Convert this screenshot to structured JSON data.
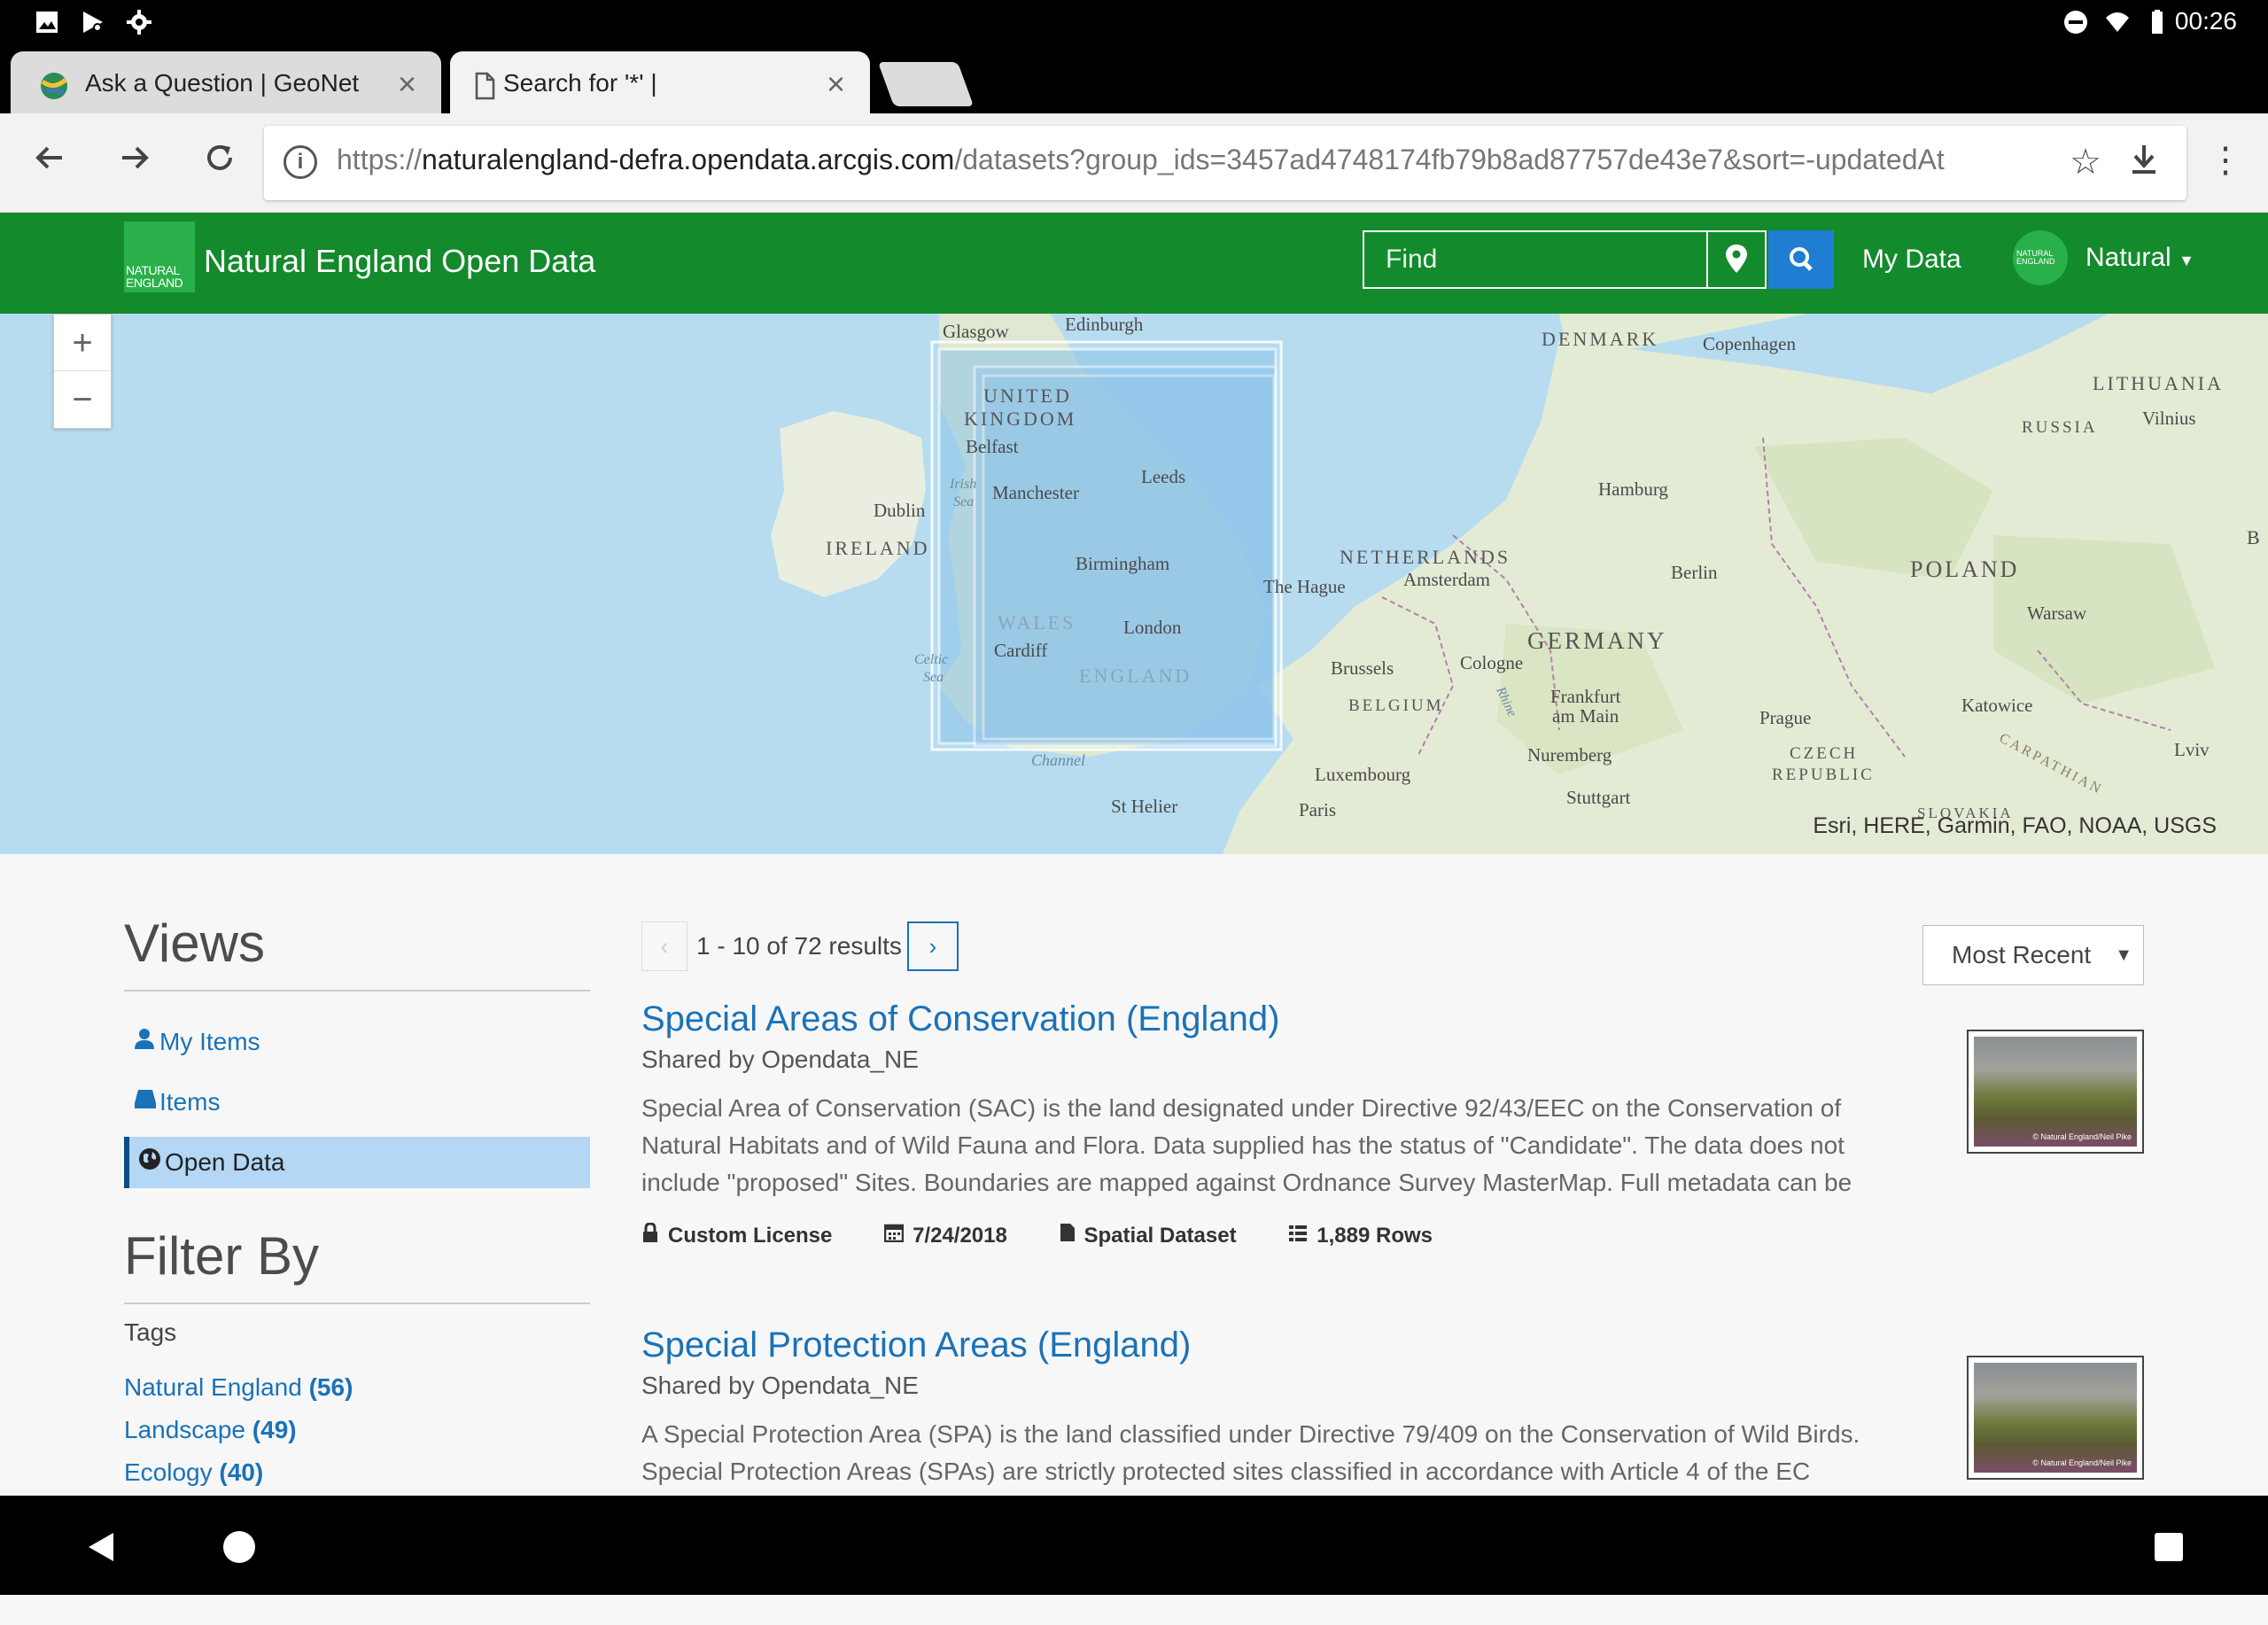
{
  "status_bar": {
    "time": "00:26",
    "left_icons": [
      "image-icon",
      "play-store-icon",
      "settings-gear-icon"
    ],
    "right_icons": [
      "do-not-disturb-icon",
      "wifi-icon",
      "battery-icon"
    ]
  },
  "browser": {
    "tabs": [
      {
        "title": "Ask a Question | GeoNet",
        "favicon": "globe-favicon",
        "active": false
      },
      {
        "title": "Search for '*' |",
        "favicon": "page-icon",
        "active": true
      }
    ],
    "url_host": "naturalengland-defra.opendata.arcgis.com",
    "url_scheme": "https://",
    "url_path": "/datasets?group_ids=3457ad4748174fb79b8ad87757de43e7&sort=-updatedAt"
  },
  "header": {
    "logo_text": "NATURAL ENGLAND",
    "title": "Natural England Open Data",
    "find_placeholder": "Find",
    "my_data": "My Data",
    "avatar_text": "NATURAL ENGLAND",
    "user": "Natural",
    "accent": "#138a2c",
    "search_button_color": "#1f7ed1"
  },
  "map": {
    "zoom_in": "+",
    "zoom_out": "−",
    "attribution": "Esri, HERE, Garmin, FAO, NOAA, USGS",
    "labels": {
      "glasgow": "Glasgow",
      "edinburgh": "Edinburgh",
      "united": "UNITED",
      "kingdom": "KINGDOM",
      "belfast": "Belfast",
      "irish_sea": "Irish",
      "irish_sea2": "Sea",
      "dublin": "Dublin",
      "ireland": "IRELAND",
      "manchester": "Manchester",
      "leeds": "Leeds",
      "birmingham": "Birmingham",
      "wales": "WALES",
      "cardiff": "Cardiff",
      "london": "London",
      "england": "ENGLAND",
      "celtic": "Celtic",
      "celtic2": "Sea",
      "channel": "Channel",
      "st_helier": "St Helier",
      "denmark": "DENMARK",
      "copenhagen": "Copenhagen",
      "lithuania": "LITHUANIA",
      "vilnius": "Vilnius",
      "russia": "RUSSIA",
      "hamburg": "Hamburg",
      "netherlands": "NETHERLANDS",
      "amsterdam": "Amsterdam",
      "the_hague": "The Hague",
      "berlin": "Berlin",
      "poland": "POLAND",
      "warsaw": "Warsaw",
      "germany": "GERMANY",
      "brussels": "Brussels",
      "cologne": "Cologne",
      "belgium": "BELGIUM",
      "frankfurt": "Frankfurt",
      "am_main": "am Main",
      "prague": "Prague",
      "katowice": "Katowice",
      "lviv": "Lviv",
      "luxembourg": "Luxembourg",
      "nuremberg": "Nuremberg",
      "czech": "CZECH",
      "republic": "REPUBLIC",
      "paris": "Paris",
      "stuttgart": "Stuttgart",
      "slovakia": "SLOVAKIA",
      "carpathian": "CARPATHIAN",
      "rhine": "Rhine",
      "b": "B"
    }
  },
  "sidebar": {
    "views_title": "Views",
    "items": [
      {
        "label": "My Items",
        "icon": "user-icon",
        "active": false
      },
      {
        "label": "Items",
        "icon": "drive-icon",
        "active": false
      },
      {
        "label": "Open Data",
        "icon": "globe-icon",
        "active": true
      }
    ],
    "filter_title": "Filter By",
    "tags_label": "Tags",
    "tags": [
      {
        "label": "Natural England",
        "count": "(56)"
      },
      {
        "label": "Landscape",
        "count": "(49)"
      },
      {
        "label": "Ecology",
        "count": "(40)"
      }
    ]
  },
  "results": {
    "prev": "‹",
    "next": "›",
    "count_text": "1 - 10 of 72 results",
    "sort_label": "Most Recent",
    "items": [
      {
        "title": "Special Areas of Conservation (England)",
        "owner": "Shared by Opendata_NE",
        "description": "Special Area of Conservation (SAC) is the land designated under Directive 92/43/EEC on the Conservation of Natural Habitats and of Wild Fauna and Flora. Data supplied has the status of \"Candidate\". The data does not include \"proposed\" Sites. Boundaries are mapped against Ordnance Survey MasterMap. Full metadata can be",
        "license": "Custom License",
        "date": "7/24/2018",
        "type": "Spatial Dataset",
        "rows": "1,889 Rows",
        "thumb_caption": "© Natural England/Neil Pike"
      },
      {
        "title": "Special Protection Areas (England)",
        "owner": "Shared by Opendata_NE",
        "description": "A Special Protection Area (SPA) is the land classified under Directive 79/409 on the Conservation of Wild Birds. Special Protection Areas (SPAs) are strictly protected sites classified in accordance with Article 4 of the EC",
        "license": "",
        "date": "",
        "type": "",
        "rows": "",
        "thumb_caption": "© Natural England/Neil Pike"
      }
    ]
  }
}
